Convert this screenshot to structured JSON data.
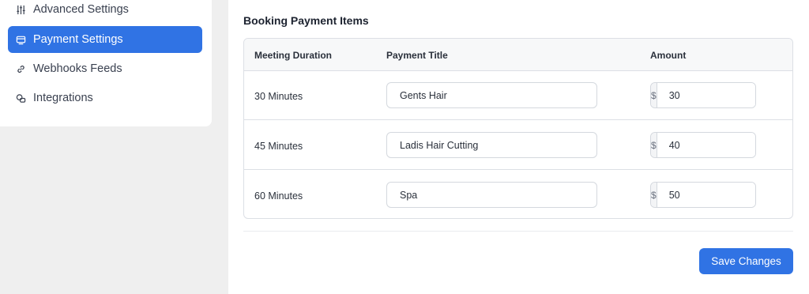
{
  "sidebar": {
    "items": [
      {
        "label": "Advanced Settings",
        "icon": "sliders-icon",
        "active": false
      },
      {
        "label": "Payment Settings",
        "icon": "payment-icon",
        "active": true
      },
      {
        "label": "Webhooks Feeds",
        "icon": "link-icon",
        "active": false
      },
      {
        "label": "Integrations",
        "icon": "integrations-icon",
        "active": false
      }
    ]
  },
  "section": {
    "title": "Booking Payment Items"
  },
  "table": {
    "headers": [
      "Meeting Duration",
      "Payment Title",
      "Amount"
    ],
    "rows": [
      {
        "duration": "30 Minutes",
        "title": "Gents Hair",
        "currency": "$",
        "amount": "30"
      },
      {
        "duration": "45 Minutes",
        "title": "Ladis Hair Cutting",
        "currency": "$",
        "amount": "40"
      },
      {
        "duration": "60 Minutes",
        "title": "Spa",
        "currency": "$",
        "amount": "50"
      }
    ]
  },
  "actions": {
    "save_label": "Save Changes"
  },
  "colors": {
    "accent": "#3073e4",
    "background": "#efefef"
  }
}
